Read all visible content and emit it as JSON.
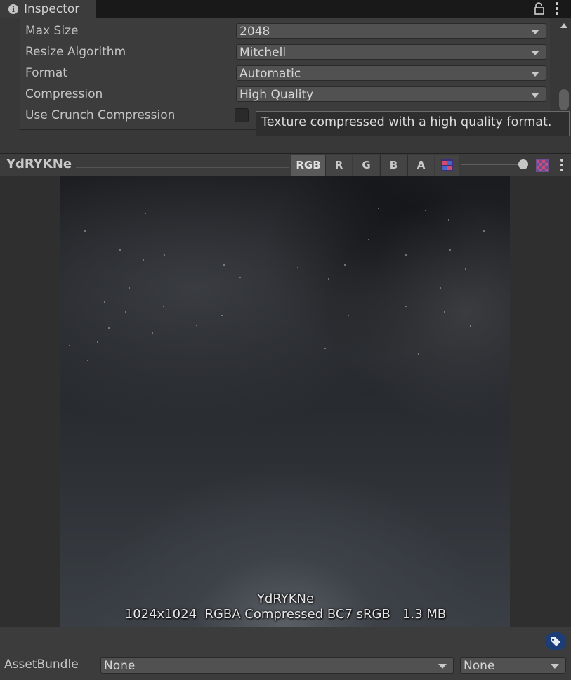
{
  "tab": {
    "title": "Inspector",
    "icon": "info-icon"
  },
  "header_icons": {
    "lock": "lock-icon",
    "menu": "kebab-menu-icon"
  },
  "settings": {
    "rows": [
      {
        "label": "Max Size",
        "value": "2048"
      },
      {
        "label": "Resize Algorithm",
        "value": "Mitchell"
      },
      {
        "label": "Format",
        "value": "Automatic"
      },
      {
        "label": "Compression",
        "value": "High Quality"
      }
    ],
    "crunch_label": "Use Crunch Compression",
    "crunch_checked": false
  },
  "tooltip": "Texture compressed with a high quality format.",
  "preview": {
    "title": "YdRYKNe",
    "channels": [
      "RGB",
      "R",
      "G",
      "B",
      "A"
    ],
    "active_channel": "RGB",
    "mip_level": 1.0,
    "overlay_name": "YdRYKNe",
    "overlay_info": "1024x1024  RGBA Compressed BC7 sRGB   1.3 MB"
  },
  "asset_bundle": {
    "label": "AssetBundle",
    "name_value": "None",
    "variant_value": "None"
  },
  "colors": {
    "panel": "#3c3c3c",
    "dropdown": "#515151",
    "tag_button": "#1d3d77"
  }
}
